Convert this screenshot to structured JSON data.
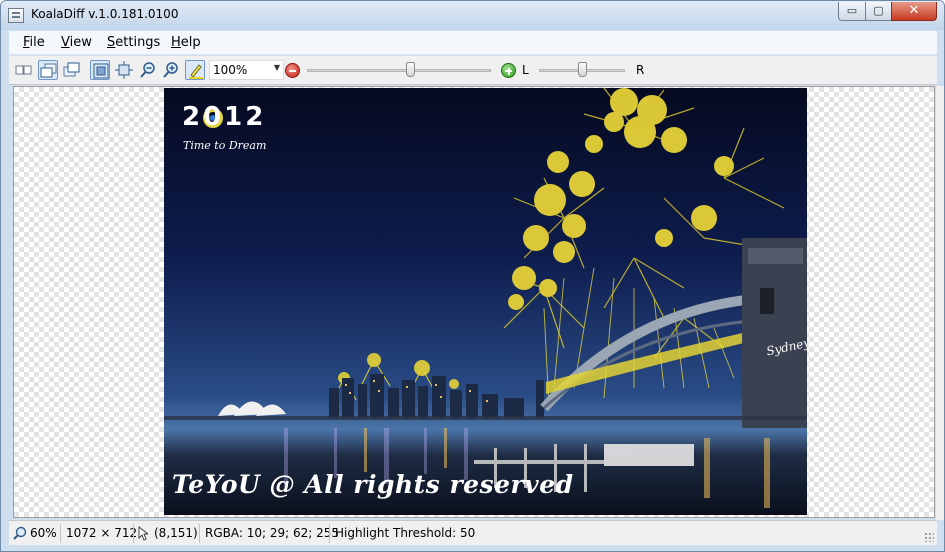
{
  "window": {
    "title": "KoalaDiff v.1.0.181.0100"
  },
  "titlebar": {
    "min_glyph": "▭",
    "max_glyph": "▢",
    "close_glyph": "✕"
  },
  "menu": [
    {
      "accel": "F",
      "rest": "ile"
    },
    {
      "accel": "V",
      "rest": "iew"
    },
    {
      "accel": "S",
      "rest": "ettings"
    },
    {
      "accel": "H",
      "rest": "elp"
    }
  ],
  "toolbar": {
    "icons": [
      "side-by-side-icon",
      "overlay-left-icon",
      "overlay-right-icon",
      "fit-to-window-icon",
      "actual-size-icon",
      "zoom-out-icon",
      "zoom-in-icon",
      "highlight-icon"
    ],
    "zoom_value": "100%",
    "threshold_slider_fraction": 0.56,
    "lr_slider_fraction": 0.5,
    "left_label": "L",
    "right_label": "R"
  },
  "image": {
    "logo_year": "2012",
    "logo_subtitle": "Time to Dream",
    "watermark": "TeYoU @ All rights reserved",
    "sign_text": "Sydney"
  },
  "status": {
    "zoom": "60%",
    "dimensions": "1072 × 712",
    "cursor_pos": "(8,151)",
    "rgba": "RGBA: 10; 29; 62; 255",
    "threshold": "Highlight Threshold: 50"
  },
  "colors": {
    "accent": "#6f97c8",
    "firework": "#e9d43a"
  }
}
